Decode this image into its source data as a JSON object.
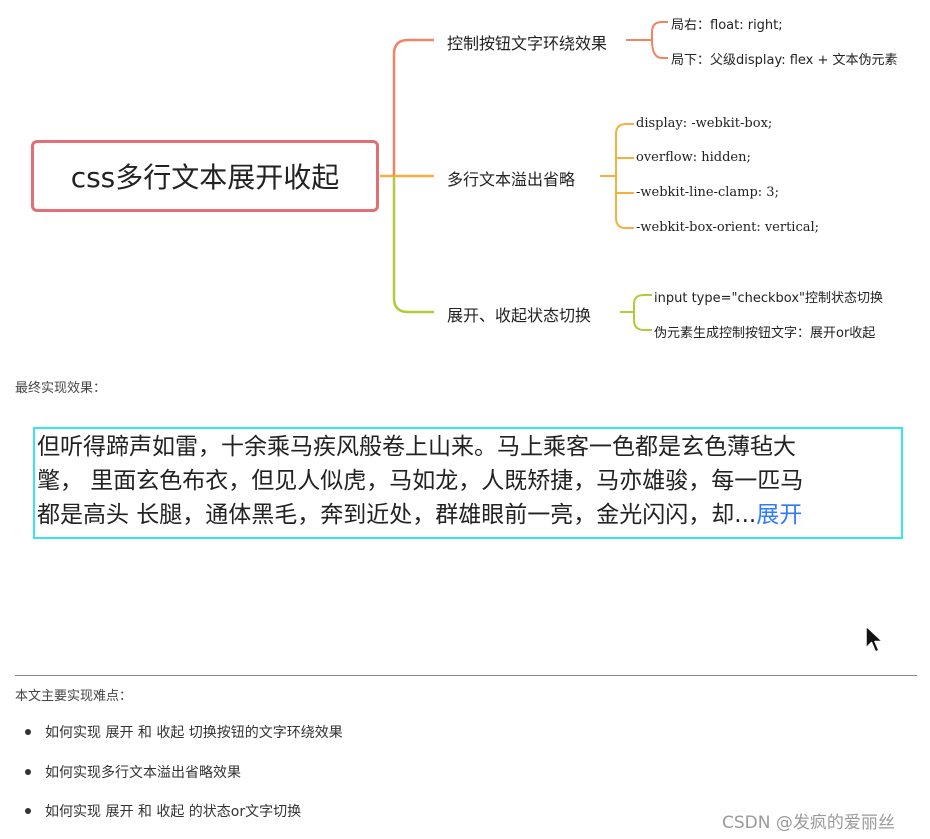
{
  "mindmap": {
    "root": "css多行文本展开收起",
    "branches": [
      {
        "label": "控制按钮文字环绕效果",
        "color": "#f08565",
        "children": [
          "局右：float: right;",
          "局下：父级display: flex + 文本伪元素"
        ]
      },
      {
        "label": "多行文本溢出省略",
        "color": "#f7b03e",
        "children": [
          "display: -webkit-box;",
          "overflow: hidden;",
          "-webkit-line-clamp: 3;",
          "-webkit-box-orient: vertical;"
        ]
      },
      {
        "label": "展开、收起状态切换",
        "color": "#b5c93a",
        "children": [
          "input type=\"checkbox\"控制状态切换",
          "伪元素生成控制按钮文字：展开or收起"
        ]
      }
    ],
    "root_border_color": "#e26f74"
  },
  "result_label": "最终实现效果：",
  "demo": {
    "lines": [
      "但听得蹄声如雷，十余乘马疾风般卷上山来。马上乘客一色都是玄色薄毡大",
      "氅， 里面玄色布衣，但见人似虎，马如龙，人既矫捷，马亦雄骏，每一匹马",
      "都是高头 长腿，通体黑毛，奔到近处，群雄眼前一亮，金光闪闪，却..."
    ],
    "expand_label": "展开",
    "border_color": "#37e5f2",
    "link_color": "#2f7cf6"
  },
  "difficulties_label": "本文主要实现难点：",
  "difficulties": [
    "如何实现 展开 和 收起 切换按钮的文字环绕效果",
    "如何实现多行文本溢出省略效果",
    "如何实现 展开 和 收起 的状态or文字切换"
  ],
  "watermark": "CSDN @发疯的爱丽丝",
  "icons": {
    "cursor": "mouse-pointer-icon"
  }
}
